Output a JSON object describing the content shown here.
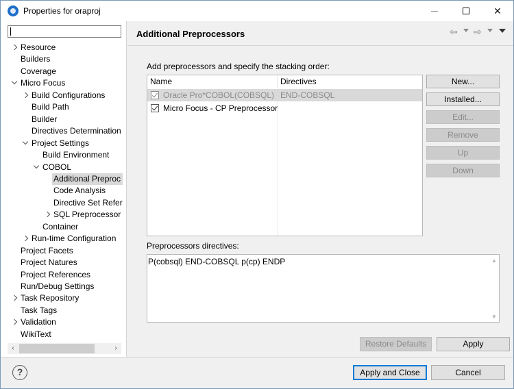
{
  "window": {
    "title": "Properties for oraproj",
    "minimize": "",
    "maximize": "",
    "close": "✕"
  },
  "nav": {
    "filter_value": "",
    "items": [
      {
        "label": "Resource",
        "depth": 0,
        "twisty": "closed"
      },
      {
        "label": "Builders",
        "depth": 0,
        "twisty": "none"
      },
      {
        "label": "Coverage",
        "depth": 0,
        "twisty": "none"
      },
      {
        "label": "Micro Focus",
        "depth": 0,
        "twisty": "open"
      },
      {
        "label": "Build Configurations",
        "depth": 1,
        "twisty": "closed"
      },
      {
        "label": "Build Path",
        "depth": 1,
        "twisty": "none"
      },
      {
        "label": "Builder",
        "depth": 1,
        "twisty": "none"
      },
      {
        "label": "Directives Determination",
        "depth": 1,
        "twisty": "none"
      },
      {
        "label": "Project Settings",
        "depth": 1,
        "twisty": "open"
      },
      {
        "label": "Build Environment",
        "depth": 2,
        "twisty": "none"
      },
      {
        "label": "COBOL",
        "depth": 2,
        "twisty": "open"
      },
      {
        "label": "Additional Preproc",
        "depth": 3,
        "twisty": "none",
        "selected": true
      },
      {
        "label": "Code Analysis",
        "depth": 3,
        "twisty": "none"
      },
      {
        "label": "Directive Set Refer",
        "depth": 3,
        "twisty": "none"
      },
      {
        "label": "SQL Preprocessor",
        "depth": 3,
        "twisty": "closed"
      },
      {
        "label": "Container",
        "depth": 2,
        "twisty": "none"
      },
      {
        "label": "Run-time Configuration",
        "depth": 1,
        "twisty": "closed"
      },
      {
        "label": "Project Facets",
        "depth": 0,
        "twisty": "none"
      },
      {
        "label": "Project Natures",
        "depth": 0,
        "twisty": "none"
      },
      {
        "label": "Project References",
        "depth": 0,
        "twisty": "none"
      },
      {
        "label": "Run/Debug Settings",
        "depth": 0,
        "twisty": "none"
      },
      {
        "label": "Task Repository",
        "depth": 0,
        "twisty": "closed"
      },
      {
        "label": "Task Tags",
        "depth": 0,
        "twisty": "none"
      },
      {
        "label": "Validation",
        "depth": 0,
        "twisty": "closed"
      },
      {
        "label": "WikiText",
        "depth": 0,
        "twisty": "none"
      }
    ],
    "scroll_left": "‹",
    "scroll_right": "›"
  },
  "page": {
    "title": "Additional Preprocessors",
    "nav_back": "⇦",
    "nav_forward": "⇨",
    "instruction": "Add preprocessors and specify the stacking order:",
    "table": {
      "columns": [
        "Name",
        "Directives"
      ],
      "rows": [
        {
          "name": "Oracle Pro*COBOL(COBSQL)",
          "directives": "END-COBSQL",
          "checked": true,
          "dimmed": true,
          "selected": true
        },
        {
          "name": "Micro Focus - CP Preprocessor",
          "directives": "",
          "checked": true,
          "dimmed": false,
          "selected": false
        }
      ]
    },
    "buttons": {
      "new": "New...",
      "installed": "Installed...",
      "edit": "Edit...",
      "remove": "Remove",
      "up": "Up",
      "down": "Down"
    },
    "directives_label": "Preprocessors directives:",
    "directives_value": "P(cobsql) END-COBSQL p(cp) ENDP",
    "scroll_up": "▲",
    "scroll_down": "▼",
    "restore_defaults": "Restore Defaults",
    "apply": "Apply"
  },
  "footer": {
    "help": "?",
    "apply_and_close": "Apply and Close",
    "cancel": "Cancel"
  }
}
